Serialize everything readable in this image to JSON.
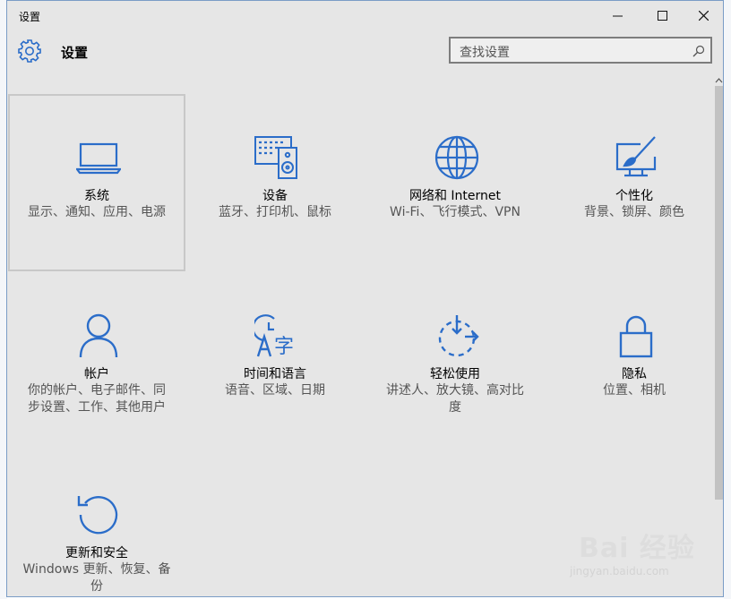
{
  "window": {
    "title": "设置",
    "minimize_label": "—",
    "maximize_label": "☐",
    "close_label": "✕"
  },
  "header": {
    "app_title": "设置",
    "icon": "gear-icon",
    "search_placeholder": "查找设置",
    "search_icon": "search-icon"
  },
  "accent_color": "#2b6dc9",
  "tiles": [
    {
      "name": "系统",
      "desc": "显示、通知、应用、电源",
      "icon": "laptop-icon",
      "selected": true
    },
    {
      "name": "设备",
      "desc": "蓝牙、打印机、鼠标",
      "icon": "devices-icon"
    },
    {
      "name": "网络和 Internet",
      "desc": "Wi-Fi、飞行模式、VPN",
      "icon": "globe-icon"
    },
    {
      "name": "个性化",
      "desc": "背景、锁屏、颜色",
      "icon": "paint-icon"
    },
    {
      "name": "帐户",
      "desc": "你的帐户、电子邮件、同步设置、工作、其他用户",
      "icon": "person-icon"
    },
    {
      "name": "时间和语言",
      "desc": "语音、区域、日期",
      "icon": "time-language-icon"
    },
    {
      "name": "轻松使用",
      "desc": "讲述人、放大镜、高对比度",
      "icon": "ease-of-access-icon"
    },
    {
      "name": "隐私",
      "desc": "位置、相机",
      "icon": "lock-icon"
    },
    {
      "name": "更新和安全",
      "desc": "Windows 更新、恢复、备份",
      "icon": "refresh-icon"
    }
  ],
  "watermark": {
    "brand": "Bai 经验",
    "url": "jingyan.baidu.com"
  }
}
